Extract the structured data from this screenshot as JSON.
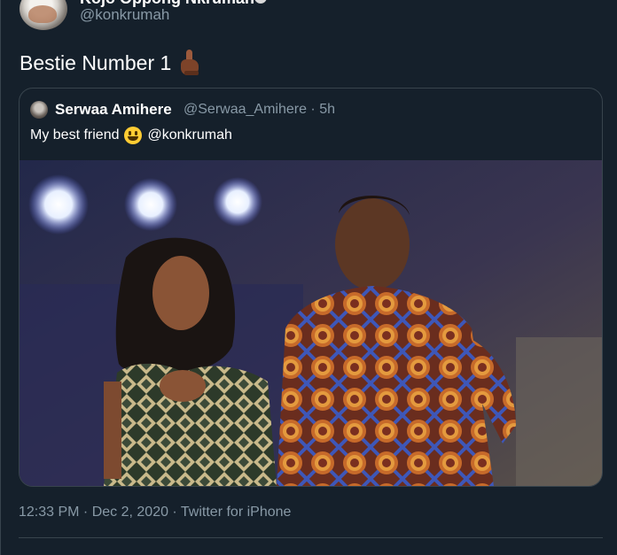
{
  "tweet": {
    "author": {
      "display_name": "Kojo Oppong Nkrumah",
      "handle": "@konkrumah"
    },
    "text": "Bestie Number 1",
    "emoji": "backhand-index-pointing-up-dark",
    "timestamp": "12:33 PM · Dec 2, 2020 · Twitter for iPhone"
  },
  "quoted_tweet": {
    "display_name": "Serwaa Amihere",
    "handle_meta": "@Serwaa_Amihere · 5h",
    "text_before": "My best friend",
    "emoji": "grinning-face",
    "text_after": "@konkrumah"
  },
  "colors": {
    "background": "#15202b",
    "border": "#38444d",
    "secondary_text": "#8899a6",
    "primary_text": "#ffffff"
  }
}
